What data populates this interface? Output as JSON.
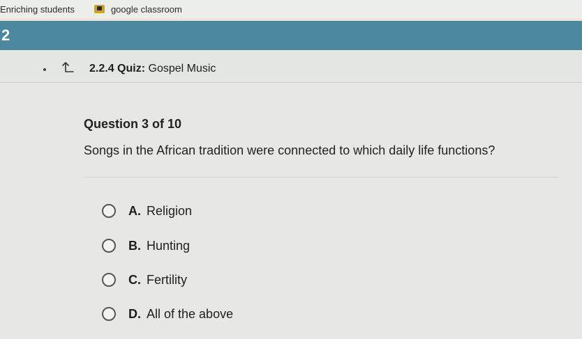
{
  "bookmarks": [
    {
      "label": "Enriching students"
    },
    {
      "label": "google classroom",
      "icon": "classroom-icon"
    }
  ],
  "course": {
    "number": "2"
  },
  "quiz": {
    "code": "2.2.4",
    "type": "Quiz:",
    "title": "Gospel Music"
  },
  "question": {
    "number_label": "Question 3 of 10",
    "text": "Songs in the African tradition were connected to which daily life functions?"
  },
  "options": [
    {
      "letter": "A.",
      "text": "Religion"
    },
    {
      "letter": "B.",
      "text": "Hunting"
    },
    {
      "letter": "C.",
      "text": "Fertility"
    },
    {
      "letter": "D.",
      "text": "All of the above"
    }
  ],
  "colors": {
    "banner": "#4b879f",
    "background": "#e7e8e5",
    "bookmark_icon": "#c9a422"
  }
}
